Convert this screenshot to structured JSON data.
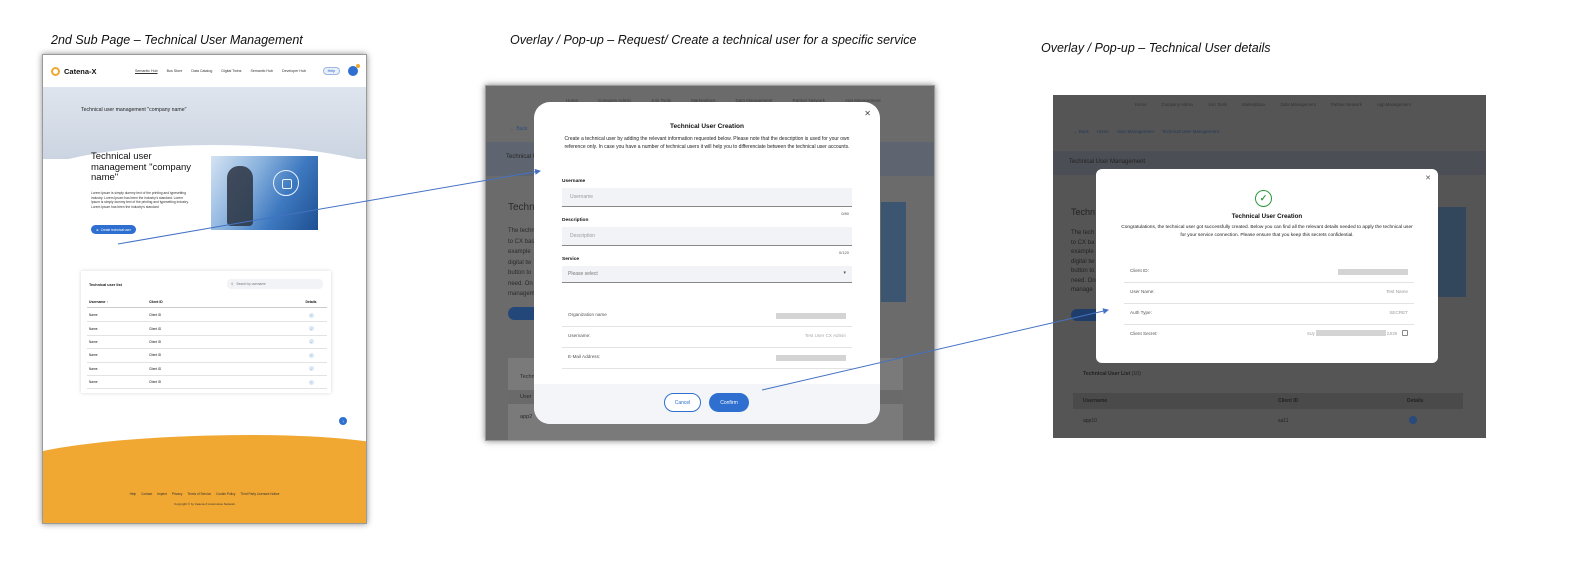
{
  "captions": {
    "panel1": "2nd Sub Page – Technical User Management",
    "panel2": "Overlay / Pop-up – Request/ Create a technical user for a specific service",
    "panel3": "Overlay / Pop-up – Technical User details"
  },
  "subpage": {
    "brand": "Catena-X",
    "nav": [
      "Semantic Hub",
      "Bus Store",
      "Data Catalog",
      "Digital Twins",
      "Semantic Hub",
      "Developer Hub"
    ],
    "help": "Help",
    "hero_title": "Technical user management \"company name\"",
    "intro_title": "Technical user management \"company name\"",
    "intro_text": "Lorem Ipsum is simply dummy text of the printing and typesetting industry. Lorem Ipsum has been the industry's standard. Lorem Ipsum is simply dummy text of the printing and typesetting industry. Lorem Ipsum has been the industry's standard",
    "create_button": "Create technical user",
    "table": {
      "title": "Technical user list",
      "search_placeholder": "Search by username",
      "headers": [
        "Username",
        "Client ID",
        "Details"
      ],
      "rows": [
        {
          "username": "Name",
          "client_id": "Client ID"
        },
        {
          "username": "Name",
          "client_id": "Client ID"
        },
        {
          "username": "Name",
          "client_id": "Client ID"
        },
        {
          "username": "Name",
          "client_id": "Client ID"
        },
        {
          "username": "Name",
          "client_id": "Client ID"
        },
        {
          "username": "Name",
          "client_id": "Client ID"
        }
      ]
    },
    "footer_links": [
      "Help",
      "Contact",
      "Imprint",
      "Privacy",
      "Terms of Service",
      "Cookie Policy",
      "Third Party Licenses Notice"
    ],
    "copyright": "Copyright © by Catena-X Automotive Network"
  },
  "create_modal": {
    "background": {
      "nav": [
        "Home",
        "Company Admin",
        "Join Tools",
        "Marketplace",
        "Data Management",
        "Partner Network",
        "App Management"
      ],
      "back": "Back",
      "band_title": "Technical User Management",
      "title": "Technical",
      "text_lines": [
        "The technical",
        "to CX bas",
        "example",
        "digital tw",
        "button to",
        "need. On",
        "managem"
      ],
      "list_title": "Technical User List",
      "user_header": "User",
      "row_username": "app2",
      "row_client": "sa12"
    },
    "title": "Technical User Creation",
    "description": "Create a technical user by adding the relevant information requested below. Please note that the description is used for your own reference only. In case you have a number of technical users it will help you to differenciate between the technical user accounts.",
    "username_label": "Username",
    "username_placeholder": "Username",
    "username_count": "0/80",
    "description_label": "Description",
    "description_placeholder": "Description",
    "description_count": "0/120",
    "service_label": "Service",
    "service_placeholder": "Please select",
    "info": [
      {
        "label": "Organization name",
        "value": ""
      },
      {
        "label": "Username:",
        "value": "Test User CX Admin"
      },
      {
        "label": "E-Mail Address:",
        "value": ""
      }
    ],
    "cancel": "Cancel",
    "confirm": "Confirm"
  },
  "details_modal": {
    "background": {
      "nav": [
        "Home",
        "Company Admin",
        "Join Tools",
        "Marketplace",
        "Data Management",
        "Partner Network",
        "App Management"
      ],
      "crumbs": [
        "Back",
        "Home",
        "User Management",
        "Technical User Management"
      ],
      "band_title": "Technical User Management",
      "title": "Techn",
      "text_lines": [
        "The tech",
        "to CX ba",
        "example",
        "digital tw",
        "button to",
        "need. On",
        "manage"
      ],
      "list_title": "Technical User List",
      "list_count": "(10)",
      "headers": [
        "Username",
        "Client ID",
        "Details"
      ],
      "row_username": "app10",
      "row_client": "sa11"
    },
    "title": "Technical User Creation",
    "description": "Congratulations, the technical user got successfully created. Below you can find all the relevant details needed to apply the technical user for your service connection. Please ensure that you keep this secrets confidential.",
    "rows": [
      {
        "label": "Client ID:",
        "value": ""
      },
      {
        "label": "User Name:",
        "value": "Test Name"
      },
      {
        "label": "Auth Type:",
        "value": "SECRET"
      },
      {
        "label": "Client Secret:",
        "prefix": "5Uy",
        "suffix": "2JI29"
      }
    ]
  }
}
